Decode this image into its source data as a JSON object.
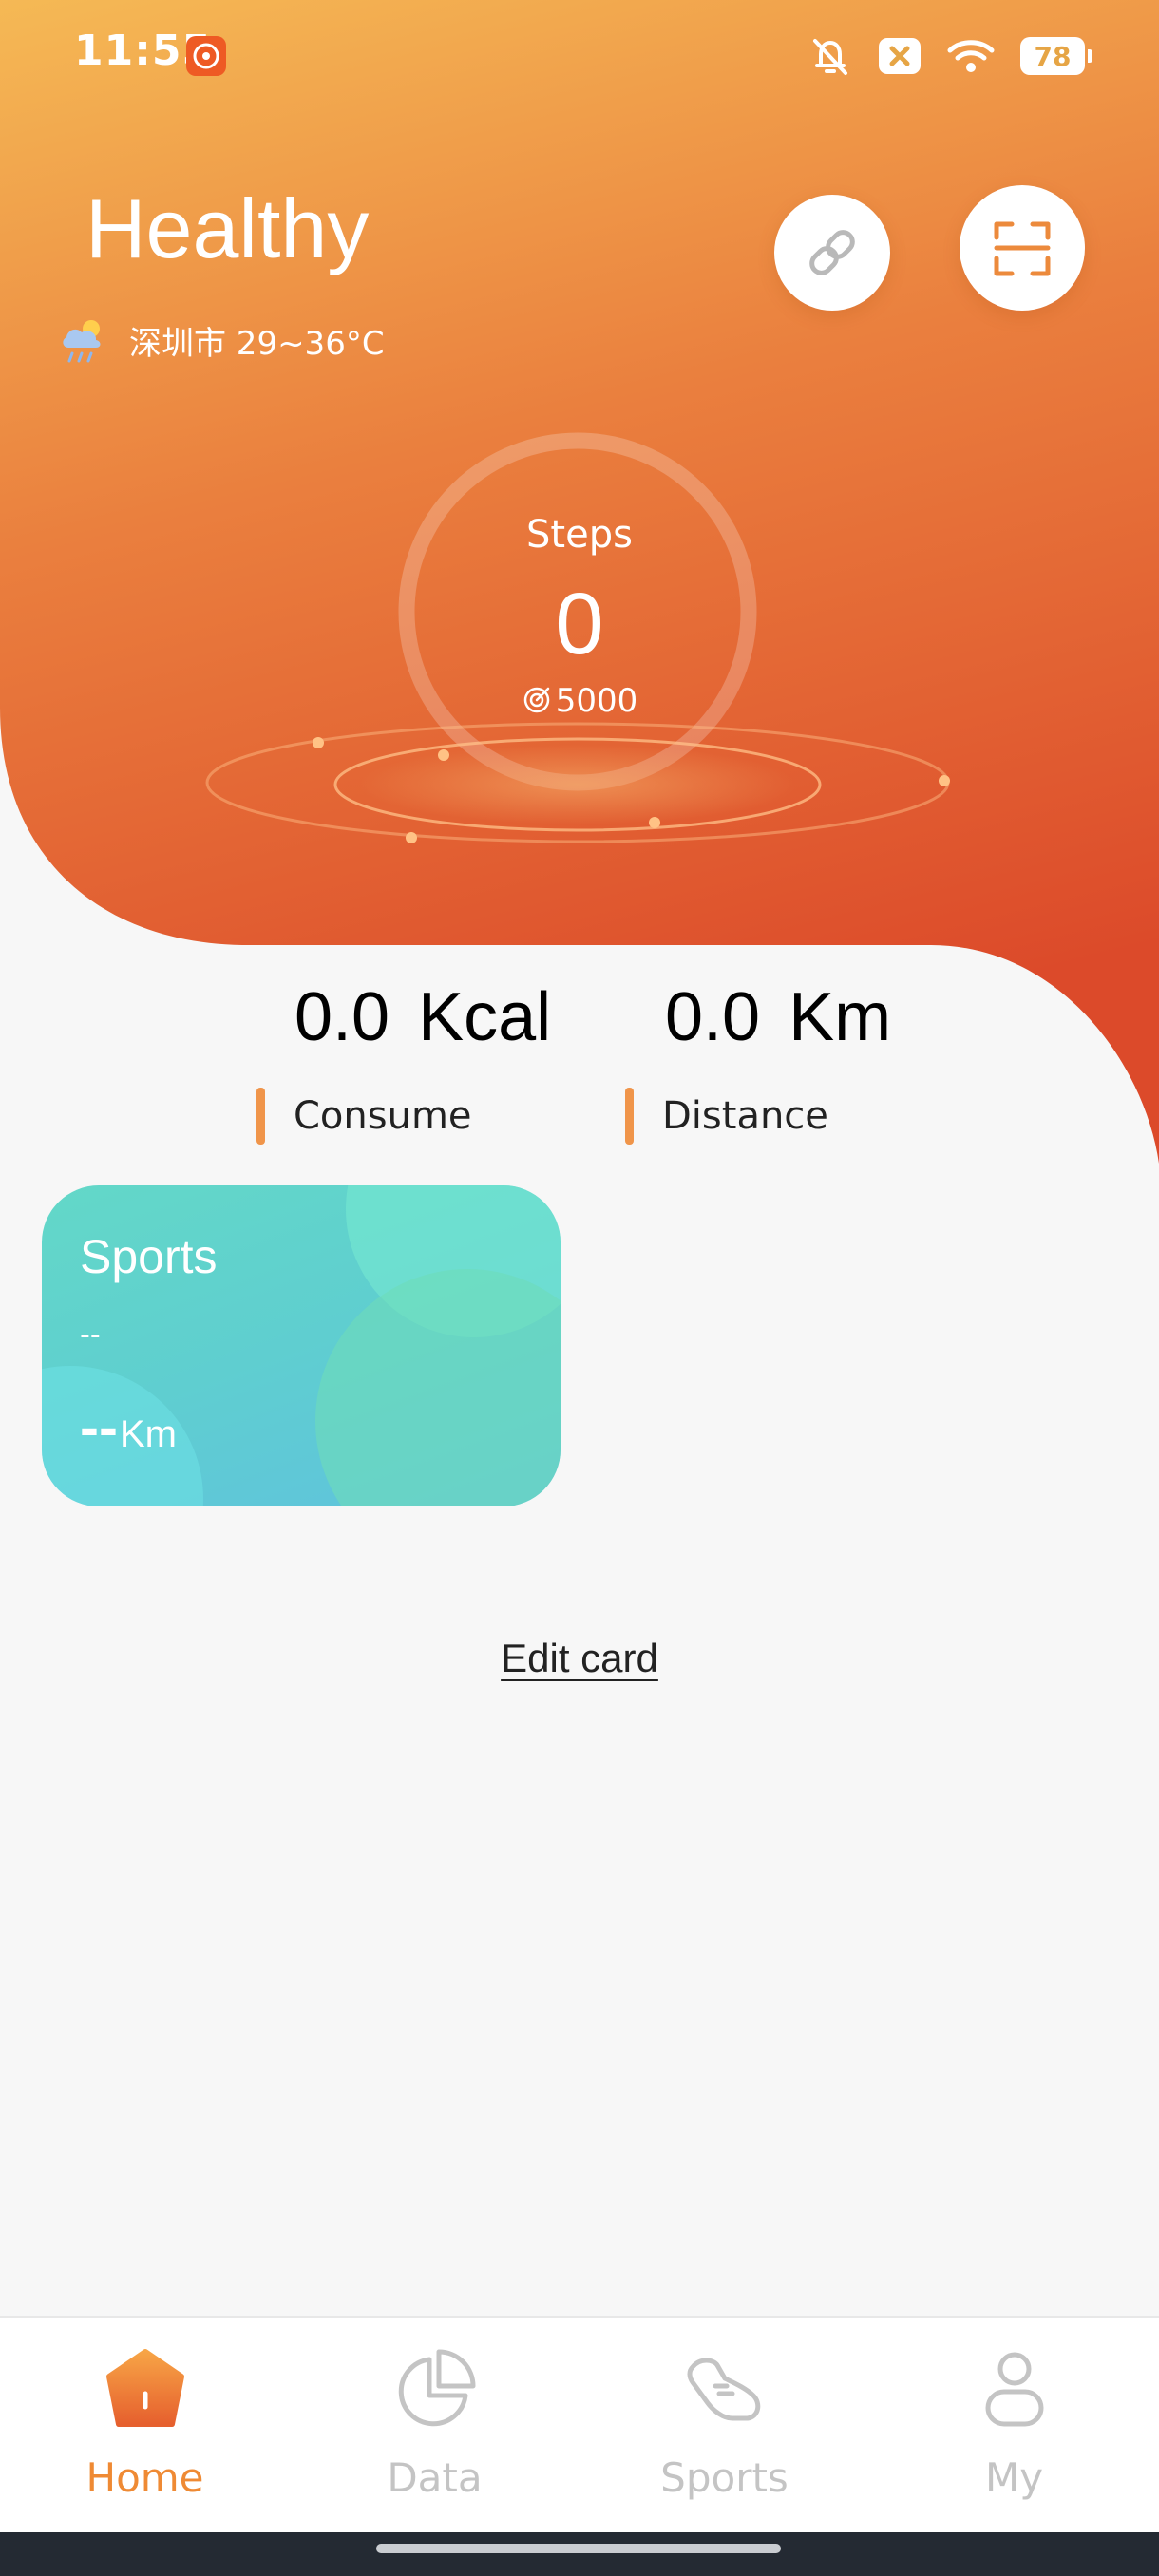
{
  "status_bar": {
    "time": "11:55",
    "battery": "78",
    "icons": [
      "mute-bell-icon",
      "close-box-icon",
      "wifi-icon",
      "battery-icon"
    ]
  },
  "header": {
    "title": "Healthy",
    "weather_text": "深圳市 29~36°C",
    "weather_icon": "rain-cloud-icon",
    "link_icon": "link-icon",
    "scan_icon": "scan-icon"
  },
  "steps": {
    "label": "Steps",
    "value": "0",
    "goal": "5000"
  },
  "stats": {
    "consume_value": "0.0",
    "consume_unit": "Kcal",
    "consume_label": "Consume",
    "distance_value": "0.0",
    "distance_unit": "Km",
    "distance_label": "Distance"
  },
  "sports_card": {
    "title": "Sports",
    "subtitle": "--",
    "distance_value": "--",
    "distance_unit": "Km"
  },
  "edit_card": "Edit card",
  "nav": {
    "home": "Home",
    "data": "Data",
    "sports": "Sports",
    "my": "My"
  },
  "colors": {
    "accent": "#ef8a34",
    "gradient_top": "#f5b955",
    "gradient_bottom": "#dc4a2a",
    "card": "#5fd0cc"
  }
}
